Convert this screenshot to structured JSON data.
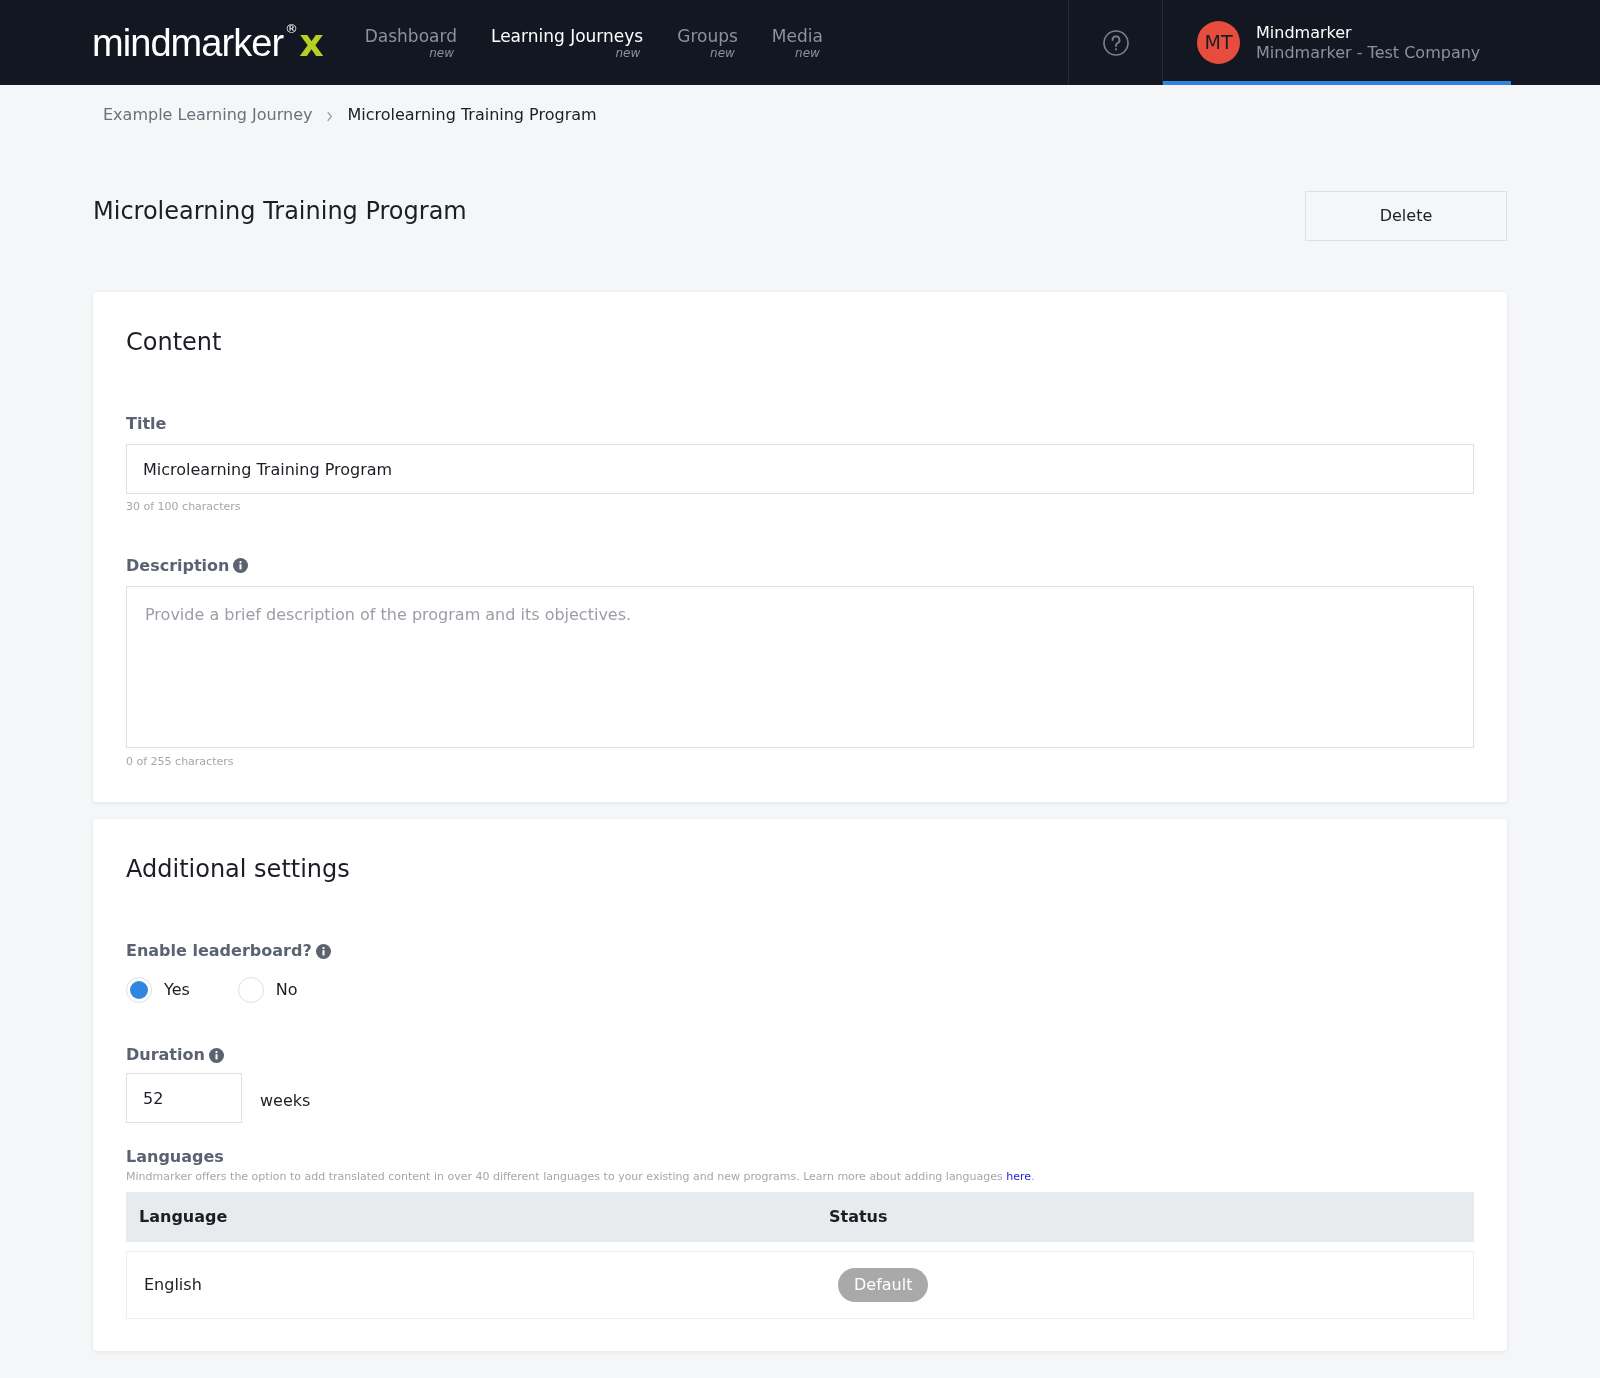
{
  "header": {
    "logo": {
      "text": "mindmarker",
      "mark": "®",
      "suffix": "x"
    },
    "nav": [
      {
        "label": "Dashboard",
        "badge": "new",
        "selected": false
      },
      {
        "label": "Learning Journeys",
        "badge": "new",
        "selected": true
      },
      {
        "label": "Groups",
        "badge": "new",
        "selected": false
      },
      {
        "label": "Media",
        "badge": "new",
        "selected": false
      }
    ],
    "user": {
      "initials": "MT",
      "name": "Mindmarker",
      "company": "Mindmarker - Test Company",
      "color": "#e84c3d"
    }
  },
  "breadcrumb": [
    "Example Learning Journey",
    "Microlearning Training Program"
  ],
  "page_title": "Microlearning Training Program",
  "delete_button": "Delete",
  "content": {
    "heading": "Content",
    "title_field": {
      "label": "Title",
      "value": "Microlearning Training Program",
      "counter": "30 of 100 characters"
    },
    "description_field": {
      "label": "Description",
      "placeholder": "Provide a brief description of the program and its objectives.",
      "counter": "0 of 255 characters"
    }
  },
  "settings": {
    "heading": "Additional settings",
    "leaderboard": {
      "label": "Enable leaderboard?",
      "options": [
        {
          "label": "Yes",
          "selected": true
        },
        {
          "label": "No",
          "selected": false
        }
      ]
    },
    "duration": {
      "label": "Duration",
      "value": "52",
      "unit": "weeks"
    },
    "languages": {
      "label": "Languages",
      "note": "Mindmarker offers the option to add translated content in over 40 different languages to your existing and new programs. Learn more about adding languages ",
      "link": "here",
      "note_end": ".",
      "columns": [
        "Language",
        "Status"
      ],
      "rows": [
        {
          "language": "English",
          "status": "Default"
        }
      ]
    }
  }
}
